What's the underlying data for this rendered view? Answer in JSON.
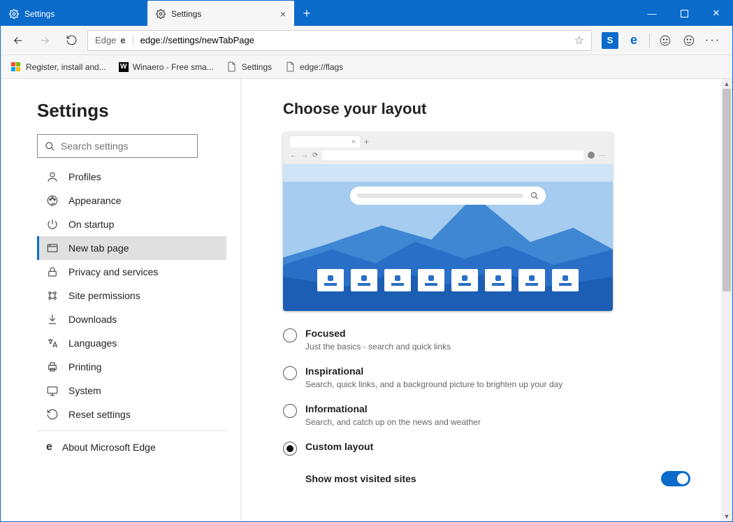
{
  "titlebar": {
    "tabs": [
      {
        "label": "Settings",
        "active": false
      },
      {
        "label": "Settings",
        "active": true
      }
    ]
  },
  "window_controls": {
    "minimize": "—",
    "maximize": "▢",
    "close": "✕"
  },
  "toolbar": {
    "address_prefix": "Edge",
    "url": "edge://settings/newTabPage"
  },
  "extensions": {
    "skype": "S",
    "edge": "e"
  },
  "bookmarks": [
    {
      "icon": "win",
      "label": "Register, install and..."
    },
    {
      "icon": "winaero",
      "label": "Winaero - Free sma..."
    },
    {
      "icon": "page",
      "label": "Settings"
    },
    {
      "icon": "page",
      "label": "edge://flags"
    }
  ],
  "sidebar": {
    "title": "Settings",
    "search_placeholder": "Search settings",
    "items": [
      {
        "label": "Profiles",
        "icon": "person"
      },
      {
        "label": "Appearance",
        "icon": "palette"
      },
      {
        "label": "On startup",
        "icon": "power"
      },
      {
        "label": "New tab page",
        "icon": "newtab",
        "active": true
      },
      {
        "label": "Privacy and services",
        "icon": "lock"
      },
      {
        "label": "Site permissions",
        "icon": "permissions"
      },
      {
        "label": "Downloads",
        "icon": "download"
      },
      {
        "label": "Languages",
        "icon": "languages"
      },
      {
        "label": "Printing",
        "icon": "printer"
      },
      {
        "label": "System",
        "icon": "system"
      },
      {
        "label": "Reset settings",
        "icon": "reset"
      }
    ],
    "about_label": "About Microsoft Edge"
  },
  "main": {
    "heading": "Choose your layout",
    "options": [
      {
        "id": "focused",
        "title": "Focused",
        "desc": "Just the basics - search and quick links",
        "checked": false
      },
      {
        "id": "inspirational",
        "title": "Inspirational",
        "desc": "Search, quick links, and a background picture to brighten up your day",
        "checked": false
      },
      {
        "id": "informational",
        "title": "Informational",
        "desc": "Search, and catch up on the news and weather",
        "checked": false
      },
      {
        "id": "custom",
        "title": "Custom layout",
        "desc": "",
        "checked": true
      }
    ],
    "toggle_label": "Show most visited sites",
    "toggle_on": true
  }
}
